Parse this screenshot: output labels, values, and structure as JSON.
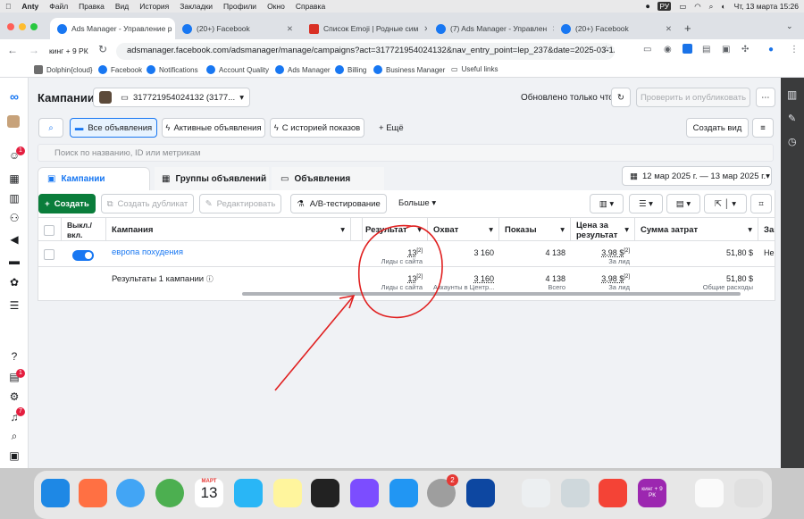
{
  "menubar": {
    "app": "Anty",
    "items": [
      "Файл",
      "Правка",
      "Вид",
      "История",
      "Закладки",
      "Профили",
      "Окно",
      "Справка"
    ],
    "keyboard": "РУ",
    "clock": "Чт, 13 марта 15:26"
  },
  "tabs": [
    {
      "title": "Ads Manager - Управление р",
      "color": "#1877f2"
    },
    {
      "title": "(20+) Facebook",
      "color": "#1877f2"
    },
    {
      "title": "Список Emoji | Родные сим",
      "color": "#d93025"
    },
    {
      "title": "(7) Ads Manager - Управлен",
      "color": "#1877f2"
    },
    {
      "title": "(20+) Facebook",
      "color": "#1877f2"
    }
  ],
  "profile_label": "кинг + 9 РК",
  "url": "adsmanager.facebook.com/adsmanager/manage/campaigns?act=317721954024132&nav_entry_point=lep_237&date=2025-03-12...",
  "bookmarks": [
    "Dolphin{cloud}",
    "Facebook",
    "Notifications",
    "Account Quality",
    "Ads Manager",
    "Billing",
    "Business Manager",
    "Useful links"
  ],
  "header": {
    "title": "Кампании",
    "account": "317721954024132 (3177...",
    "updated": "Обновлено только что",
    "review_publish": "Проверить и опубликовать",
    "create_view": "Создать вид"
  },
  "filters": {
    "all_ads": "Все объявления",
    "active_ads": "Активные объявления",
    "with_history": "С историей показов",
    "more": "Ещё",
    "search_placeholder": "Поиск по названию, ID или метрикам"
  },
  "level_tabs": {
    "campaigns": "Кампании",
    "adsets": "Группы объявлений",
    "ads": "Объявления"
  },
  "date_range": "12 мар 2025 г. — 13 мар 2025 г.",
  "actions": {
    "create": "Создать",
    "duplicate": "Создать дубликат",
    "edit": "Редактировать",
    "ab_test": "A/B-тестирование",
    "more": "Больше"
  },
  "table": {
    "headers": [
      "Выкл./вкл.",
      "Кампания",
      "Результат",
      "Охват",
      "Показы",
      "Цена за результат",
      "Сумма затрат",
      "Зав"
    ],
    "row": {
      "name": "европа похудения",
      "result": "13",
      "result_sup": "[2]",
      "result_sub": "Лиды с сайта",
      "reach": "3 160",
      "impressions": "4 138",
      "cpr": "3,98 $",
      "cpr_sup": "[2]",
      "cpr_sub": "За лид",
      "spend": "51,80 $",
      "end": "Непр"
    },
    "summary": {
      "label": "Результаты 1 кампании",
      "result": "13",
      "result_sup": "[2]",
      "result_sub": "Лиды с сайта",
      "reach": "3 160",
      "reach_sub": "Аккаунты в Центр...",
      "impressions": "4 138",
      "impressions_sub": "Всего",
      "cpr": "3,98 $",
      "cpr_sup": "[2]",
      "cpr_sub": "За лид",
      "spend": "51,80 $",
      "spend_sub": "Общие расходы"
    }
  },
  "badges": {
    "notif1": "1",
    "notif2": "1",
    "notif3": "7",
    "dock_settings": "2"
  },
  "dock": {
    "calendar_month": "МАРТ",
    "calendar_day": "13",
    "profile_label": "кинг + 9 РК"
  },
  "annotation_color": "#e02020"
}
